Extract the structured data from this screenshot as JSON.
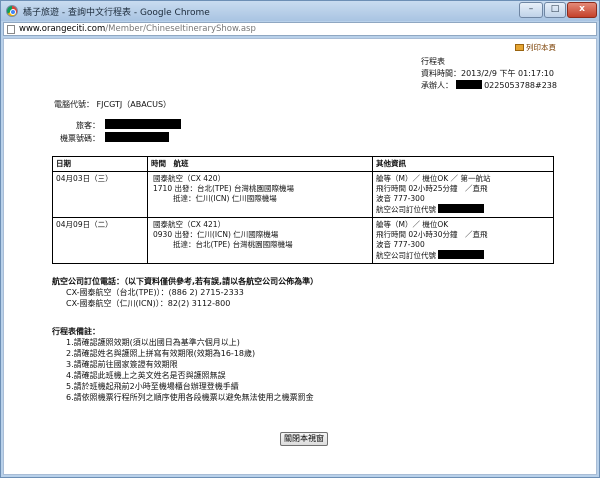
{
  "window": {
    "title": "橘子旅遊 - 查詢中文行程表 - Google Chrome",
    "minimize": "–",
    "maximize": "□",
    "close": "x"
  },
  "address": {
    "host": "www.orangeciti.com",
    "path": "/Member/ChineseItineraryShow.asp"
  },
  "page": {
    "print_label": "列印本頁",
    "meta": {
      "heading": "行程表",
      "data_time": "資料時間：2013/2/9 下午 01:17:10",
      "contact_label": "承辦人：",
      "contact_phone": "0225053788#238"
    },
    "pnr": "電腦代號： FJCGTJ（ABACUS）",
    "passenger_label": "旅客：",
    "ticket_label": "機票號碼：",
    "table": {
      "headers": [
        "日期",
        "時間　航班",
        "其他資訊"
      ],
      "rows": [
        {
          "date": "04月03日（三）",
          "flight": "國泰航空（CX 420）",
          "depart": "1710 出發：台北(TPE) 台灣桃園國際機場",
          "arrive": "抵達：仁川(ICN) 仁川國際機場",
          "info1": "艙等（M）／ 機位OK ／ 第一航站",
          "info2": "飛行時間 02小時25分鐘　／直飛",
          "info3": "波音 777-300",
          "info4": "航空公司訂位代號"
        },
        {
          "date": "04月09日（二）",
          "flight": "國泰航空（CX 421）",
          "depart": "0930 出發：仁川(ICN) 仁川國際機場",
          "arrive": "抵達：台北(TPE) 台灣桃園國際機場",
          "info1": "艙等（M）／ 機位OK",
          "info2": "飛行時間 02小時30分鐘　／直飛",
          "info3": "波音 777-300",
          "info4": "航空公司訂位代號"
        }
      ]
    },
    "airline_phones": {
      "title": "航空公司訂位電話：（以下資料僅供參考,若有誤,請以各航空公司公佈為準）",
      "lines": [
        "CX-國泰航空（台北(TPE)）：(886 2) 2715-2333",
        "CX-國泰航空（仁川(ICN)）：82(2) 3112-800"
      ]
    },
    "remarks": {
      "title": "行程表備註：",
      "lines": [
        "1.請確認護照效期(須以出國日為基準六個月以上)",
        "2.請確認姓名與護照上拼寫有效期限(效期為16-18歲)",
        "3.請確認前往國家簽證有效期限",
        "4.請確認此班機上之英文姓名是否與護照無誤",
        "5.請於班機起飛前2小時至機場櫃台辦理登機手續",
        "6.請依照機票行程所列之順序使用各段機票以避免無法使用之機票罰金"
      ]
    },
    "close_button": "關閉本視窗"
  }
}
